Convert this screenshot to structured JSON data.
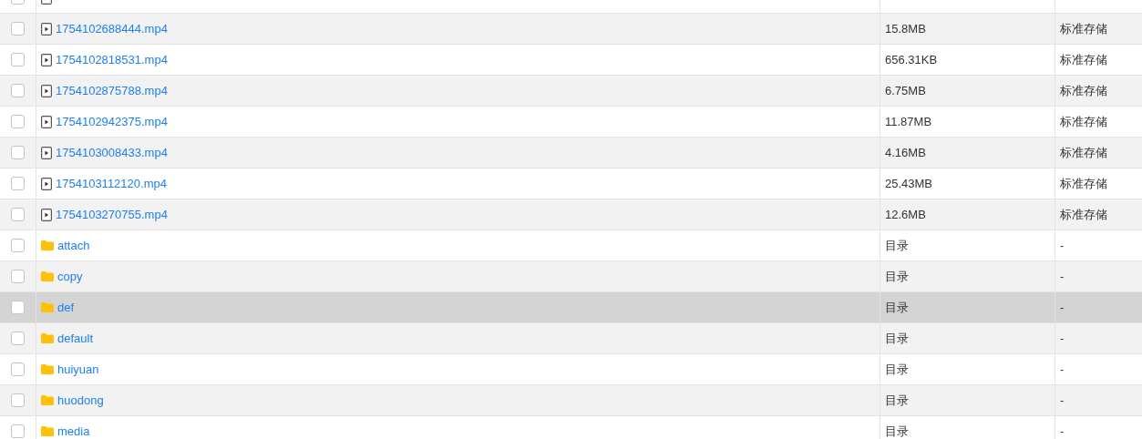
{
  "rows": [
    {
      "kind": "file",
      "checked": false,
      "highlighted": false
    },
    {
      "kind": "file",
      "name": "1754102688444.mp4",
      "size": "15.8MB",
      "storage": "标准存储",
      "checked": false,
      "highlighted": false
    },
    {
      "kind": "file",
      "name": "1754102818531.mp4",
      "size": "656.31KB",
      "storage": "标准存储",
      "checked": false,
      "highlighted": false
    },
    {
      "kind": "file",
      "name": "1754102875788.mp4",
      "size": "6.75MB",
      "storage": "标准存储",
      "checked": false,
      "highlighted": false
    },
    {
      "kind": "file",
      "name": "1754102942375.mp4",
      "size": "11.87MB",
      "storage": "标准存储",
      "checked": false,
      "highlighted": false
    },
    {
      "kind": "file",
      "name": "1754103008433.mp4",
      "size": "4.16MB",
      "storage": "标准存储",
      "checked": false,
      "highlighted": false
    },
    {
      "kind": "file",
      "name": "1754103112120.mp4",
      "size": "25.43MB",
      "storage": "标准存储",
      "checked": false,
      "highlighted": false
    },
    {
      "kind": "file",
      "name": "1754103270755.mp4",
      "size": "12.6MB",
      "storage": "标准存储",
      "checked": false,
      "highlighted": false
    },
    {
      "kind": "folder",
      "name": "attach",
      "size": "目录",
      "storage": "-",
      "checked": false,
      "highlighted": false
    },
    {
      "kind": "folder",
      "name": "copy",
      "size": "目录",
      "storage": "-",
      "checked": false,
      "highlighted": false
    },
    {
      "kind": "folder",
      "name": "def",
      "size": "目录",
      "storage": "-",
      "checked": false,
      "highlighted": true
    },
    {
      "kind": "folder",
      "name": "default",
      "size": "目录",
      "storage": "-",
      "checked": false,
      "highlighted": false
    },
    {
      "kind": "folder",
      "name": "huiyuan",
      "size": "目录",
      "storage": "-",
      "checked": false,
      "highlighted": false
    },
    {
      "kind": "folder",
      "name": "huodong",
      "size": "目录",
      "storage": "-",
      "checked": false,
      "highlighted": false
    },
    {
      "kind": "folder",
      "name": "media",
      "size": "目录",
      "storage": "-",
      "checked": false,
      "highlighted": false
    }
  ]
}
